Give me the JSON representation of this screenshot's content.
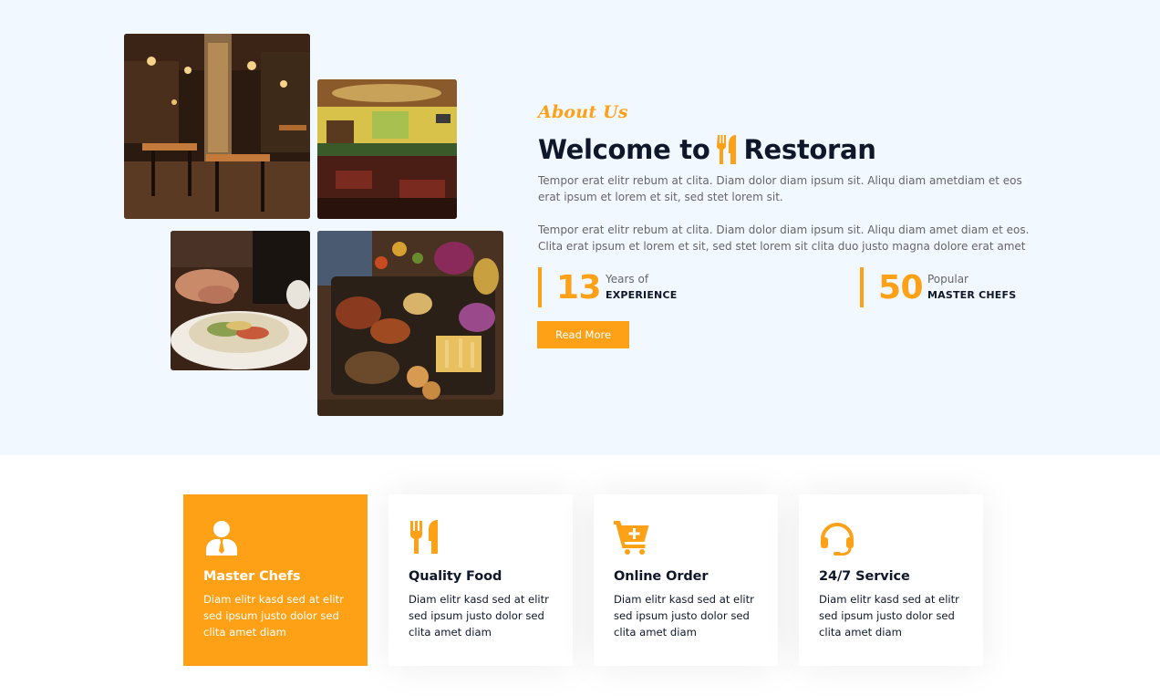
{
  "about": {
    "kicker": "About Us",
    "title_prefix": "Welcome to",
    "title_brand": "Restoran",
    "paragraph_1": "Tempor erat elitr rebum at clita. Diam dolor diam ipsum sit. Aliqu diam ametdiam et eos erat ipsum et lorem et sit, sed stet lorem sit.",
    "paragraph_2": "Tempor erat elitr rebum at clita. Diam dolor diam ipsum sit. Aliqu diam amet diam et eos. Clita erat ipsum et lorem et sit, sed stet lorem sit clita duo justo magna dolore erat amet",
    "stats": [
      {
        "number": "13",
        "line1": "Years of",
        "line2": "EXPERIENCE"
      },
      {
        "number": "50",
        "line1": "Popular",
        "line2": "MASTER CHEFS"
      }
    ],
    "read_more_label": "Read More",
    "photos": [
      "restaurant-interior-photo",
      "restaurant-bar-photo",
      "salad-dish-photo",
      "grilled-platter-photo"
    ]
  },
  "services": [
    {
      "icon": "user-tie-icon",
      "title": "Master Chefs",
      "text": "Diam elitr kasd sed at elitr sed ipsum justo dolor sed clita amet diam",
      "active": true
    },
    {
      "icon": "utensils-icon",
      "title": "Quality Food",
      "text": "Diam elitr kasd sed at elitr sed ipsum justo dolor sed clita amet diam",
      "active": false
    },
    {
      "icon": "cart-plus-icon",
      "title": "Online Order",
      "text": "Diam elitr kasd sed at elitr sed ipsum justo dolor sed clita amet diam",
      "active": false
    },
    {
      "icon": "headset-icon",
      "title": "24/7 Service",
      "text": "Diam elitr kasd sed at elitr sed ipsum justo dolor sed clita amet diam",
      "active": false
    }
  ],
  "colors": {
    "primary": "#fea116",
    "dark": "#0f172b",
    "light_bg": "#f1f8ff",
    "body_text": "#666565"
  }
}
